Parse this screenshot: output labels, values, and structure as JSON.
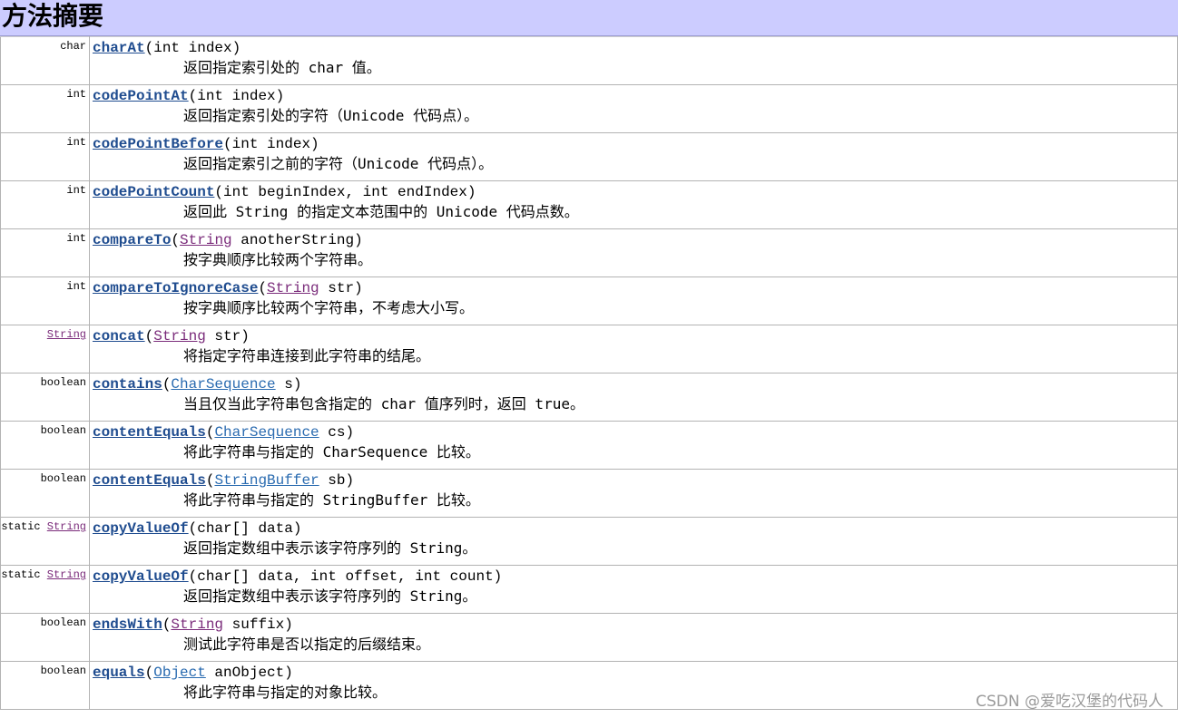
{
  "section_title": "方法摘要",
  "watermark": "CSDN @爱吃汉堡的代码人",
  "methods": [
    {
      "modifier": "char",
      "return_type": "",
      "name": "charAt",
      "params_before": "(int index)",
      "param_type": "",
      "params_after": "",
      "description": "返回指定索引处的 char 值。"
    },
    {
      "modifier": "int",
      "return_type": "",
      "name": "codePointAt",
      "params_before": "(int index)",
      "param_type": "",
      "params_after": "",
      "description": "返回指定索引处的字符（Unicode 代码点）。"
    },
    {
      "modifier": "int",
      "return_type": "",
      "name": "codePointBefore",
      "params_before": "(int index)",
      "param_type": "",
      "params_after": "",
      "description": "返回指定索引之前的字符（Unicode 代码点）。"
    },
    {
      "modifier": "int",
      "return_type": "",
      "name": "codePointCount",
      "params_before": "(int beginIndex, int endIndex)",
      "param_type": "",
      "params_after": "",
      "description": "返回此 String 的指定文本范围中的 Unicode 代码点数。"
    },
    {
      "modifier": "int",
      "return_type": "",
      "name": "compareTo",
      "params_before": "(",
      "param_type": "String",
      "params_after": " anotherString)",
      "description": "按字典顺序比较两个字符串。"
    },
    {
      "modifier": "int",
      "return_type": "",
      "name": "compareToIgnoreCase",
      "params_before": "(",
      "param_type": "String",
      "params_after": " str)",
      "description": "按字典顺序比较两个字符串，不考虑大小写。"
    },
    {
      "modifier": "",
      "return_type": "String",
      "name": "concat",
      "params_before": "(",
      "param_type": "String",
      "params_after": " str)",
      "description": "将指定字符串连接到此字符串的结尾。"
    },
    {
      "modifier": "boolean",
      "return_type": "",
      "name": "contains",
      "params_before": "(",
      "param_type": "CharSequence",
      "params_after": " s)",
      "description": "当且仅当此字符串包含指定的 char 值序列时，返回 true。"
    },
    {
      "modifier": "boolean",
      "return_type": "",
      "name": "contentEquals",
      "params_before": "(",
      "param_type": "CharSequence",
      "params_after": " cs)",
      "description": "将此字符串与指定的 CharSequence 比较。"
    },
    {
      "modifier": "boolean",
      "return_type": "",
      "name": "contentEquals",
      "params_before": "(",
      "param_type": "StringBuffer",
      "params_after": " sb)",
      "description": "将此字符串与指定的 StringBuffer 比较。"
    },
    {
      "modifier": "static",
      "return_type": "String",
      "name": "copyValueOf",
      "params_before": "(char[] data)",
      "param_type": "",
      "params_after": "",
      "description": "返回指定数组中表示该字符序列的 String。"
    },
    {
      "modifier": "static",
      "return_type": "String",
      "name": "copyValueOf",
      "params_before": "(char[] data, int offset, int count)",
      "param_type": "",
      "params_after": "",
      "description": "返回指定数组中表示该字符序列的 String。"
    },
    {
      "modifier": "boolean",
      "return_type": "",
      "name": "endsWith",
      "params_before": "(",
      "param_type": "String",
      "params_after": " suffix)",
      "description": "测试此字符串是否以指定的后缀结束。"
    },
    {
      "modifier": "boolean",
      "return_type": "",
      "name": "equals",
      "params_before": "(",
      "param_type": "Object",
      "params_after": " anObject)",
      "description": "将此字符串与指定的对象比较。"
    }
  ]
}
